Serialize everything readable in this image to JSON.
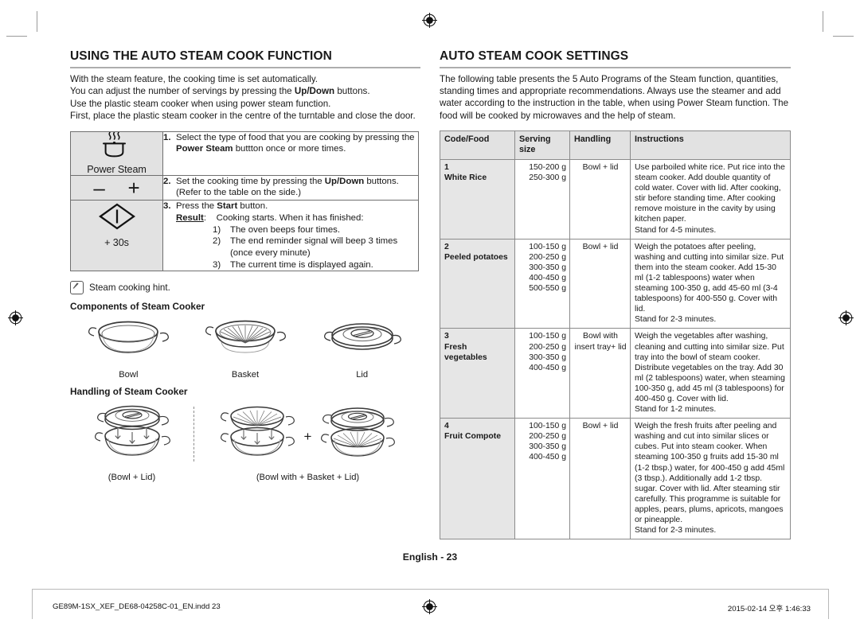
{
  "left": {
    "title": "USING THE AUTO STEAM COOK FUNCTION",
    "intro_lines": [
      "With the steam feature, the cooking time is set automatically.",
      "You can adjust the number of servings by pressing the Up/Down buttons.",
      "Use the plastic steam cooker when using power steam function.",
      "First, place the plastic steam cooker in the centre of the turntable and close the door."
    ],
    "steps": [
      {
        "num": "1.",
        "key_label": "Power Steam",
        "key_icon": "steam-pot-icon",
        "text_a": "Select the type of food that you are cooking by pressing the ",
        "bold_b": "Power Steam",
        "text_c": " buttton once or more times."
      },
      {
        "num": "2.",
        "key_minus": "–",
        "key_plus": "+",
        "text_a": "Set the cooking time by pressing the ",
        "bold_b": "Up/Down",
        "text_c": " buttons.",
        "text_d": "(Refer to the table on the side.)"
      },
      {
        "num": "3.",
        "key_label": "+ 30s",
        "key_icon": "start-diamond-icon",
        "text_a": "Press the ",
        "bold_b": "Start",
        "text_c": " button.",
        "result_label": "Result",
        "result_intro": ":    Cooking starts. When it has finished:",
        "result_items": [
          {
            "n": "1)",
            "t": "The oven beeps four times."
          },
          {
            "n": "2)",
            "t": "The end reminder signal will beep 3 times (once every minute)"
          },
          {
            "n": "3)",
            "t": "The current time is displayed again."
          }
        ]
      }
    ],
    "hint": "Steam cooking hint.",
    "components_title": "Components of Steam Cooker",
    "components": [
      {
        "caption": "Bowl",
        "icon": "bowl-icon"
      },
      {
        "caption": "Basket",
        "icon": "basket-icon"
      },
      {
        "caption": "Lid",
        "icon": "lid-icon"
      }
    ],
    "handling_title": "Handling of Steam Cooker",
    "handling": [
      {
        "caption": "(Bowl + Lid)",
        "icon": "bowl-lid-assembly-icon"
      },
      {
        "caption": "(Bowl with + Basket + Lid)",
        "icon": "bowl-basket-lid-assembly-icon",
        "plus": "+"
      }
    ]
  },
  "right": {
    "title": "AUTO STEAM COOK SETTINGS",
    "intro_lines": [
      "The following table presents the 5 Auto Programs of the Steam function, quantities,",
      "standing times and appropriate recommendations. Always use the steamer and add",
      "water according to the instruction in the table, when using Power Steam function.",
      "The food will be cooked by microwaves and the help of steam."
    ],
    "table": {
      "headers": [
        "Code/Food",
        "Serving size",
        "Handling",
        "Instructions"
      ],
      "rows": [
        {
          "code": "1",
          "food": "White Rice",
          "sizes": "150-200 g\n250-300 g",
          "handling": "Bowl + lid",
          "instructions": "Use parboiled white rice. Put rice into the steam cooker. Add double quantity of cold water. Cover with lid. After cooking, stir before standing time. After cooking remove moisture in the cavity by using kitchen paper.",
          "stand": "Stand for 4-5 minutes."
        },
        {
          "code": "2",
          "food": "Peeled potatoes",
          "sizes": "100-150 g\n200-250 g\n300-350 g\n400-450 g\n500-550 g",
          "handling": "Bowl + lid",
          "instructions": "Weigh the potatoes after peeling, washing and cutting into similar size. Put them into the steam cooker. Add 15-30 ml (1-2 tablespoons) water when steaming 100-350 g, add 45-60 ml (3-4 tablespoons) for 400-550 g. Cover with lid.",
          "stand": "Stand for 2-3 minutes."
        },
        {
          "code": "3",
          "food": "Fresh vegetables",
          "sizes": "100-150 g\n200-250 g\n300-350 g\n400-450 g",
          "handling": "Bowl with insert tray+ lid",
          "instructions": "Weigh the vegetables after washing, cleaning and cutting into similar size. Put tray into the bowl of steam cooker. Distribute vegetables on the tray. Add 30 ml (2 tablespoons) water, when steaming 100-350 g, add 45 ml (3 tablespoons) for 400-450 g. Cover with lid.",
          "stand": "Stand for 1-2 minutes."
        },
        {
          "code": "4",
          "food": "Fruit Compote",
          "sizes": "100-150 g\n200-250 g\n300-350 g\n400-450 g",
          "handling": "Bowl + lid",
          "instructions": "Weigh the fresh fruits after peeling and washing and cut into similar slices or cubes. Put into steam cooker. When steaming 100-350 g fruits add 15-30 ml (1-2 tbsp.) water, for 400-450 g add 45ml (3 tbsp.). Additionally add 1-2 tbsp. sugar. Cover with lid. After steaming stir carefully. This programme is suitable for apples, pears, plums, apricots, mangoes or pineapple.",
          "stand": "Stand for 2-3 minutes."
        }
      ]
    }
  },
  "footer": {
    "page_label": "English - 23",
    "print_left": "GE89M-1SX_XEF_DE68-04258C-01_EN.indd   23",
    "print_right": "2015-02-14   오후 1:46:33"
  }
}
